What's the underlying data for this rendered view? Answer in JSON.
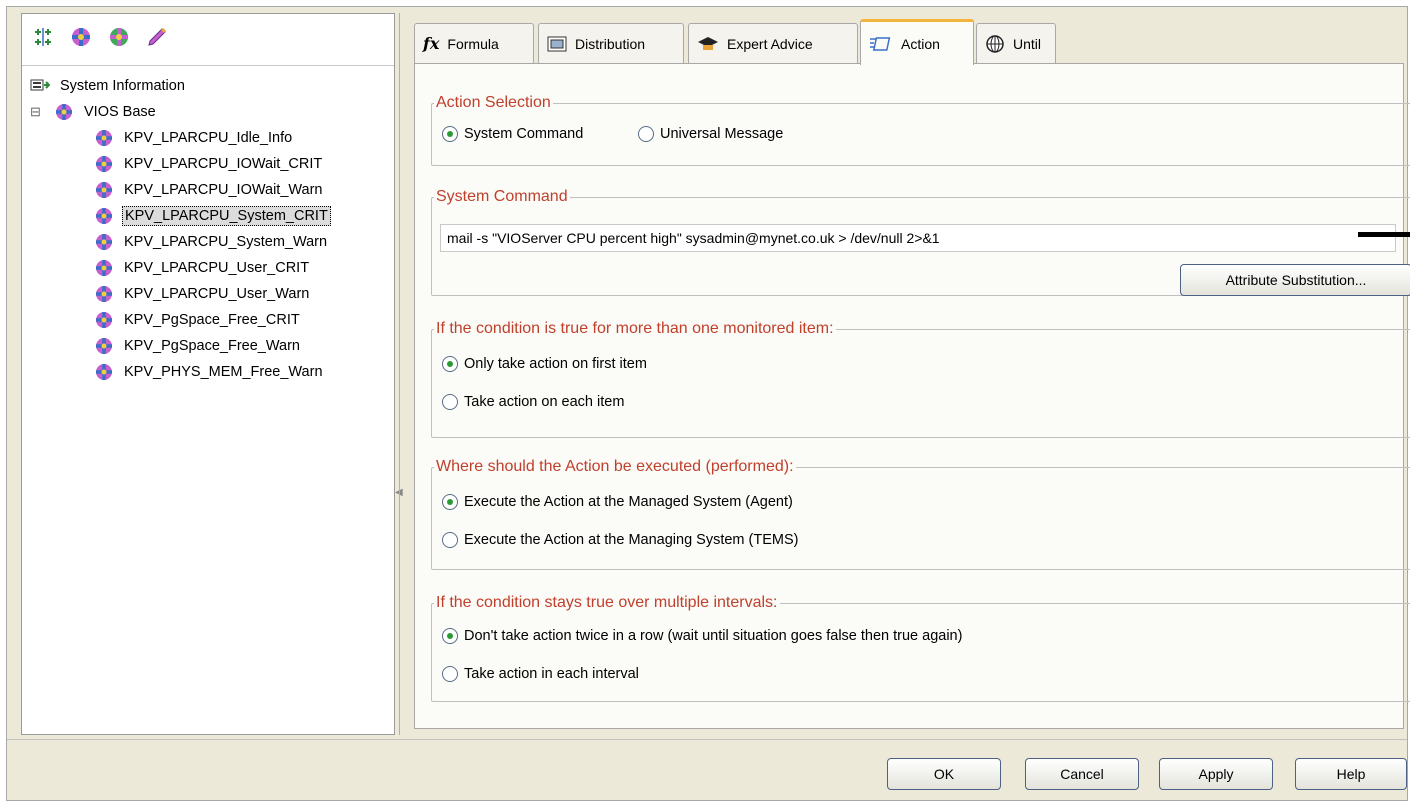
{
  "left_toolbar": {
    "icons": [
      "tree-expand-icon",
      "situation-icon",
      "situation-new-icon",
      "situation-edit-icon"
    ]
  },
  "tree": {
    "root": "System Information",
    "group": "VIOS Base",
    "group_toggle": "⊟",
    "items": [
      "KPV_LPARCPU_Idle_Info",
      "KPV_LPARCPU_IOWait_CRIT",
      "KPV_LPARCPU_IOWait_Warn",
      "KPV_LPARCPU_System_CRIT",
      "KPV_LPARCPU_System_Warn",
      "KPV_LPARCPU_User_CRIT",
      "KPV_LPARCPU_User_Warn",
      "KPV_PgSpace_Free_CRIT",
      "KPV_PgSpace_Free_Warn",
      "KPV_PHYS_MEM_Free_Warn"
    ],
    "selected_index": 3
  },
  "tabs": [
    {
      "label": "Formula",
      "icon": "fx-icon"
    },
    {
      "label": "Distribution",
      "icon": "distribution-icon"
    },
    {
      "label": "Expert Advice",
      "icon": "graduation-cap-icon"
    },
    {
      "label": "Action",
      "icon": "action-icon"
    },
    {
      "label": "Until",
      "icon": "globe-icon"
    }
  ],
  "active_tab": "Action",
  "action_selection": {
    "legend": "Action Selection",
    "options": [
      "System Command",
      "Universal Message"
    ],
    "selected": 0
  },
  "system_command": {
    "legend": "System Command",
    "value": "mail -s \"VIOServer CPU percent high\" sysadmin@mynet.co.uk > /dev/null 2>&1",
    "attribute_button": "Attribute Substitution..."
  },
  "multiple_items": {
    "legend": "If the condition is true for more than one monitored item:",
    "options": [
      "Only take action on first item",
      "Take action on each item"
    ],
    "selected": 0
  },
  "where_executed": {
    "legend": "Where should the Action be executed (performed):",
    "options": [
      "Execute the Action at the Managed System (Agent)",
      "Execute the Action at the Managing System (TEMS)"
    ],
    "selected": 0
  },
  "intervals": {
    "legend": "If the condition stays true over multiple intervals:",
    "options": [
      "Don't take action twice in a row (wait until situation goes false then true again)",
      "Take action in each interval"
    ],
    "selected": 0
  },
  "buttons": {
    "ok": "OK",
    "cancel": "Cancel",
    "apply": "Apply",
    "help": "Help"
  },
  "colors": {
    "legend": "#c0402c",
    "active_tab_accent": "#f2b43a",
    "radio_dot": "#2b9a32",
    "background": "#ece9d8"
  }
}
